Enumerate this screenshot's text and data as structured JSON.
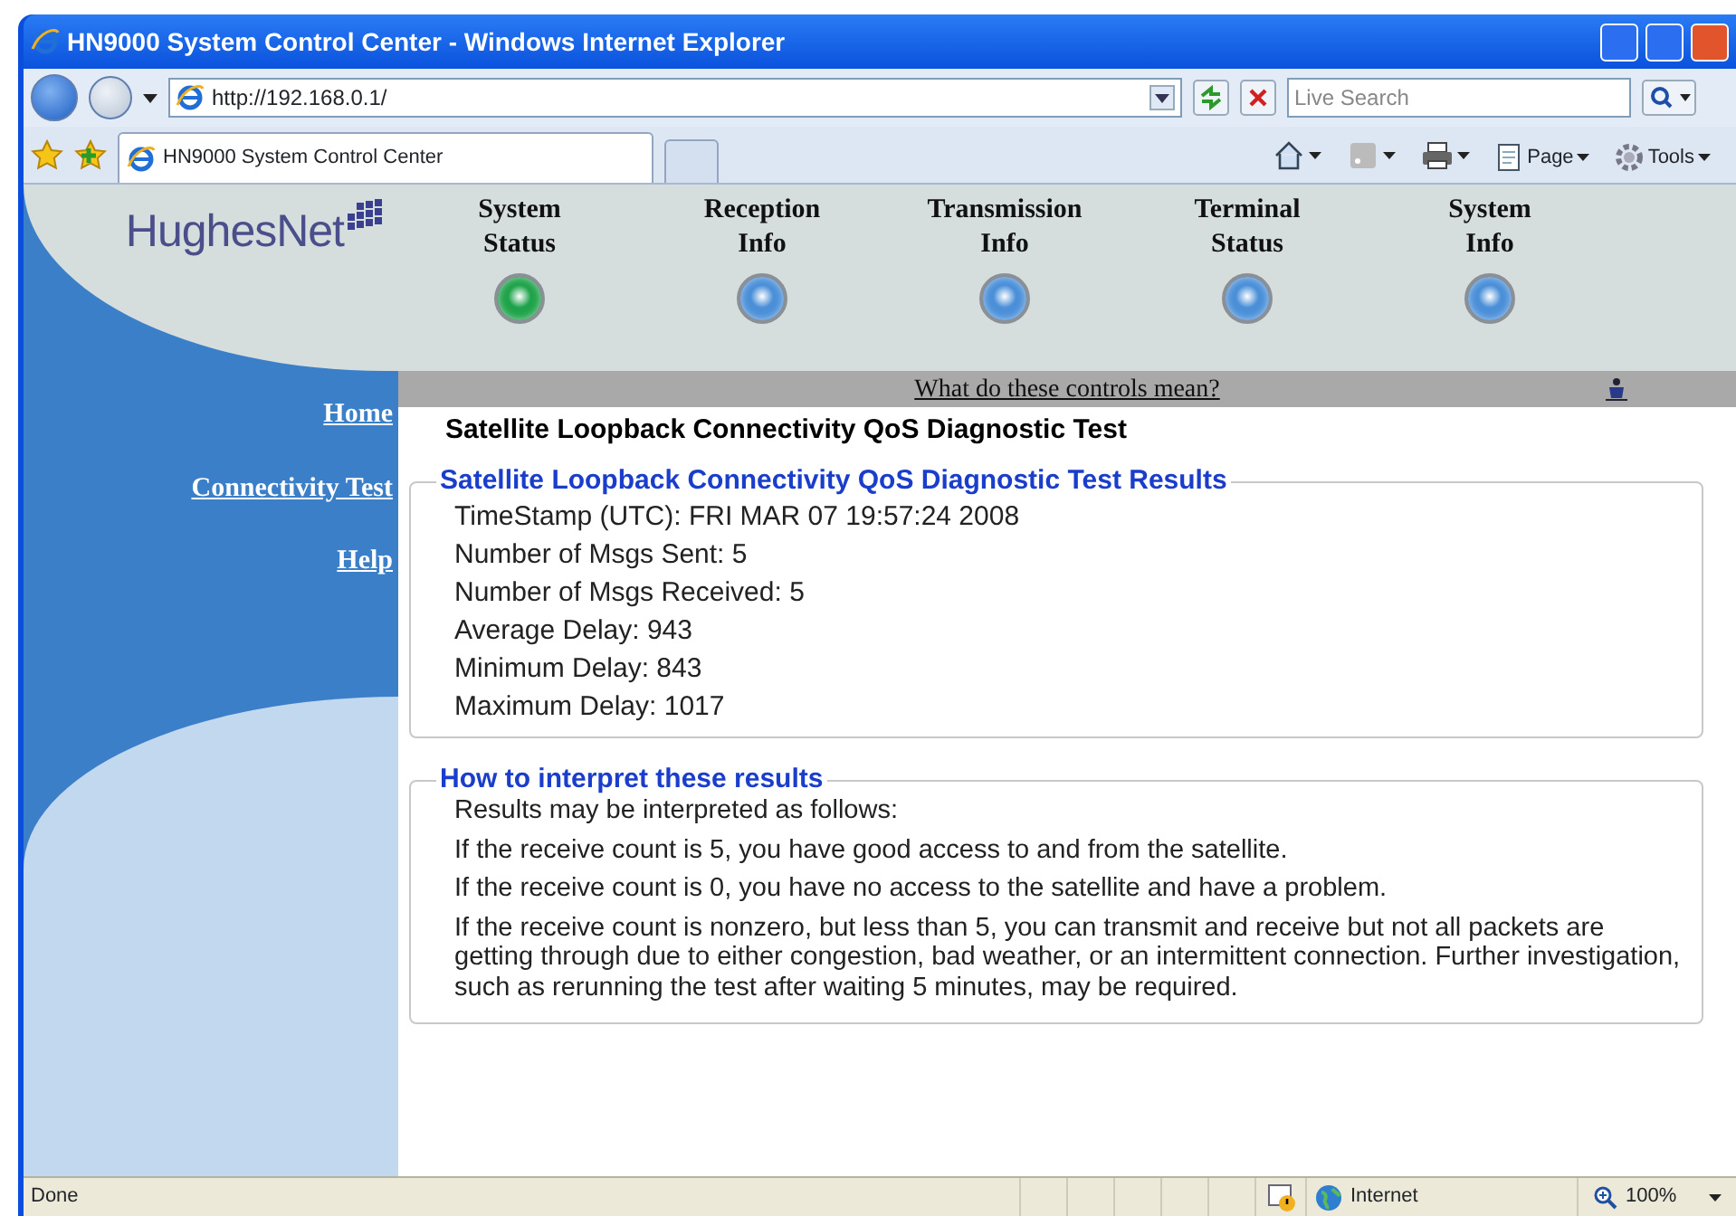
{
  "window": {
    "title": "HN9000 System Control Center - Windows Internet Explorer"
  },
  "address_bar": {
    "url": "http://192.168.0.1/"
  },
  "search": {
    "placeholder": "Live Search"
  },
  "tabs": [
    {
      "label": "HN9000 System Control Center",
      "selected": true
    }
  ],
  "command_bar": {
    "page": "Page",
    "tools": "Tools"
  },
  "page": {
    "logo": "HughesNet",
    "nav": [
      {
        "label": [
          "System",
          "Status"
        ],
        "color": "#1fa34a"
      },
      {
        "label": [
          "Reception",
          "Info"
        ],
        "color": "#4a8fd8"
      },
      {
        "label": [
          "Transmission",
          "Info"
        ],
        "color": "#4a8fd8"
      },
      {
        "label": [
          "Terminal",
          "Status"
        ],
        "color": "#4a8fd8"
      },
      {
        "label": [
          "System",
          "Info"
        ],
        "color": "#4a8fd8"
      }
    ],
    "help_link": "What do these controls mean?",
    "sidebar": [
      "Home",
      "Connectivity Test",
      "Help"
    ],
    "heading": "Satellite Loopback Connectivity QoS Diagnostic Test",
    "results": {
      "title": "Satellite Loopback Connectivity QoS Diagnostic Test Results",
      "lines": [
        "TimeStamp (UTC): FRI MAR 07 19:57:24 2008",
        "Number of Msgs Sent: 5",
        "Number of Msgs Received: 5",
        "Average Delay: 943",
        "Minimum Delay: 843",
        "Maximum Delay: 1017"
      ]
    },
    "interpretation": {
      "title": "How to interpret these results",
      "lines": [
        "Results may be interpreted as follows:",
        "If the receive count is 5, you have good access to and from the satellite.",
        "If the receive count is 0, you have no access to the satellite and have a problem.",
        "If the receive count is nonzero, but less than 5, you can transmit and receive but not all packets are getting through due to either congestion, bad weather, or an intermittent connection. Further investigation, such as rerunning the test after waiting 5 minutes, may be required."
      ]
    }
  },
  "status_bar": {
    "text": "Done",
    "zone": "Internet",
    "zoom": "100%"
  }
}
